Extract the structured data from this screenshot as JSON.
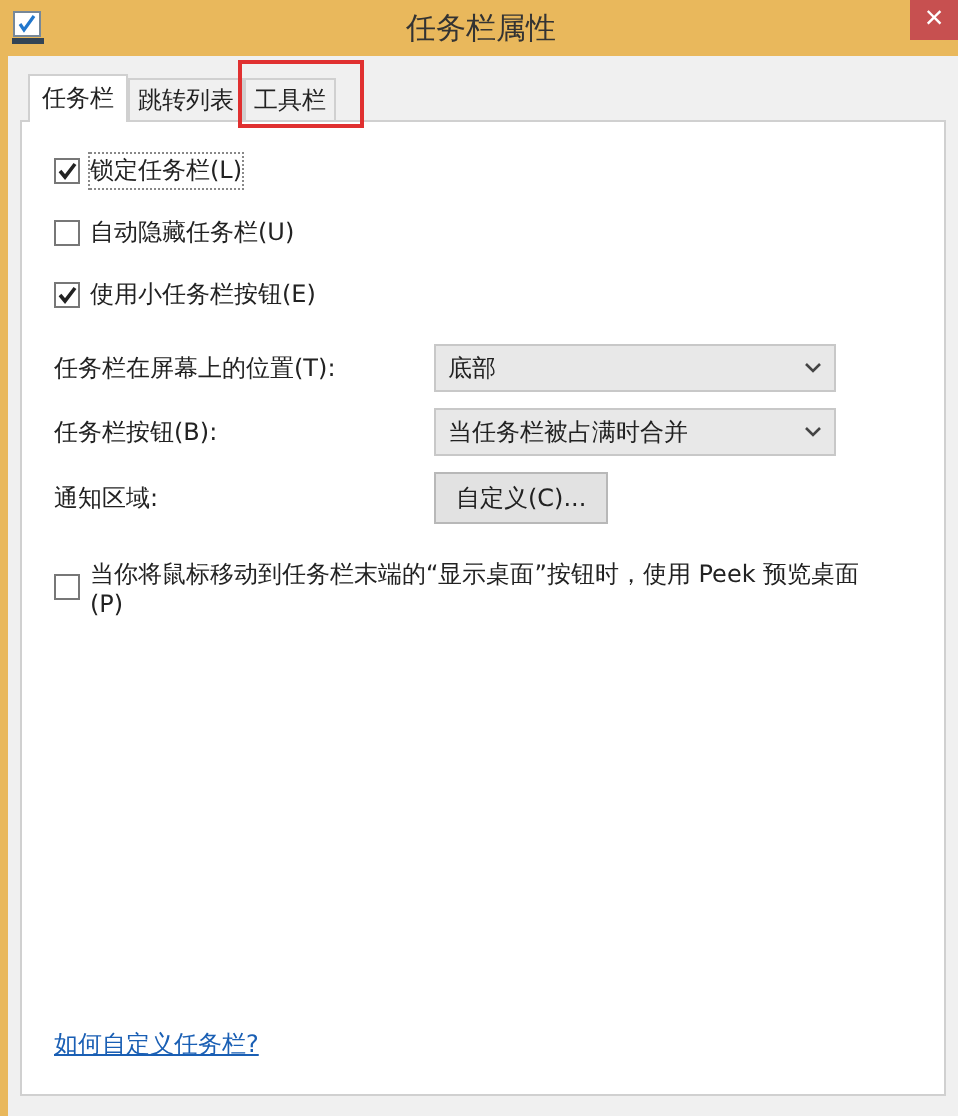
{
  "window": {
    "title": "任务栏属性",
    "close": "×"
  },
  "tabs": [
    {
      "label": "任务栏",
      "selected": true,
      "highlighted": false
    },
    {
      "label": "跳转列表",
      "selected": false,
      "highlighted": false
    },
    {
      "label": "工具栏",
      "selected": false,
      "highlighted": true
    }
  ],
  "options": [
    {
      "label": "锁定任务栏(L)",
      "checked": true
    },
    {
      "label": "自动隐藏任务栏(U)",
      "checked": false
    },
    {
      "label": "使用小任务栏按钮(E)",
      "checked": true
    }
  ],
  "settings": [
    {
      "kind": "dropdown",
      "label": "任务栏在屏幕上的位置(T):",
      "value": "底部"
    },
    {
      "kind": "dropdown",
      "label": "任务栏按钮(B):",
      "value": "当任务栏被占满时合并"
    },
    {
      "kind": "button",
      "label": "通知区域:",
      "value": "自定义(C)..."
    }
  ],
  "peek": {
    "label": "当你将鼠标移动到任务栏末端的“显示桌面”按钮时，使用 Peek 预览桌面(P)",
    "checked": false
  },
  "help_link": "如何自定义任务栏?"
}
